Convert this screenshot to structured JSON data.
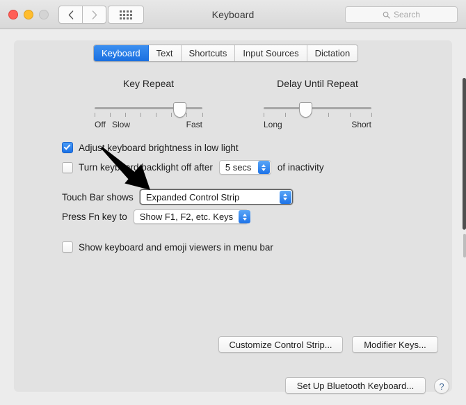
{
  "window": {
    "title": "Keyboard",
    "traffic_lights": [
      "close",
      "minimize",
      "zoom"
    ],
    "nav": {
      "back": "‹",
      "forward": "›"
    },
    "grid_button": "show-all-icon",
    "search": {
      "placeholder": "Search",
      "value": "",
      "icon": "search-icon"
    }
  },
  "tabs": [
    {
      "label": "Keyboard",
      "active": true
    },
    {
      "label": "Text",
      "active": false
    },
    {
      "label": "Shortcuts",
      "active": false
    },
    {
      "label": "Input Sources",
      "active": false
    },
    {
      "label": "Dictation",
      "active": false
    }
  ],
  "sliders": [
    {
      "title": "Key Repeat",
      "min_label": "Off",
      "second_label": "Slow",
      "max_label": "Fast",
      "ticks": 8,
      "value_index": 7,
      "value_pct": 78
    },
    {
      "title": "Delay Until Repeat",
      "min_label": "Long",
      "second_label": "",
      "max_label": "Short",
      "ticks": 6,
      "value_index": 3,
      "value_pct": 38
    }
  ],
  "options": {
    "adjust_brightness": {
      "label": "Adjust keyboard brightness in low light",
      "checked": true
    },
    "backlight_off": {
      "label": "Turn keyboard backlight off after",
      "checked": false,
      "suffix": "of inactivity",
      "popup_value": "5 secs"
    },
    "touch_bar": {
      "label": "Touch Bar shows",
      "popup_value": "Expanded Control Strip",
      "focused": true
    },
    "fn_key": {
      "label": "Press Fn key to",
      "popup_value": "Show F1, F2, etc. Keys",
      "focused": false
    },
    "show_viewers": {
      "label": "Show keyboard and emoji viewers in menu bar",
      "checked": false
    }
  },
  "buttons": {
    "customize_control_strip": "Customize Control Strip...",
    "modifier_keys": "Modifier Keys...",
    "set_up_bluetooth": "Set Up Bluetooth Keyboard...",
    "help": "?"
  },
  "annotation": {
    "type": "arrow",
    "name": "pointer-arrow-annotation",
    "color": "#000000",
    "from": [
      146,
      212
    ],
    "to": [
      216,
      273
    ]
  },
  "colors": {
    "accent": "#1d73e8",
    "tab_active_bg": "#2a7ce8",
    "window_bg": "#ececec",
    "panel_bg": "#e2e2e2"
  }
}
